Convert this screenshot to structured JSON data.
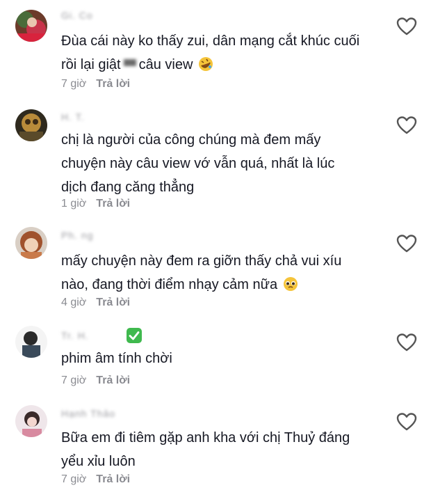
{
  "comments": [
    {
      "username": "Gi. Co",
      "text_before": "Đùa cái này ko thấy zui, dân mạng cắt khúc cuối\nrồi lại giật",
      "text_after": "câu view",
      "emoji": "rolling-on-floor-laughing",
      "time": "7 giờ",
      "reply": "Trả lời"
    },
    {
      "username": "H. T. ",
      "text": "chị là người của công chúng mà đem mấy\nchuyện này câu view vớ vẫn quá, nhất là lúc\ndịch đang căng thẳng",
      "time": "1 giờ",
      "reply": "Trả lời"
    },
    {
      "username": "Ph. ng",
      "text": "mấy chuyện này đem ra giỡn thấy chả vui xíu\nnào, đang thời điểm nhạy cảm nữa",
      "emoji": "pleading-face",
      "time": "4 giờ",
      "reply": "Trả lời"
    },
    {
      "username": "Tr. H.",
      "verified": true,
      "text": "phim âm tính chời",
      "time": "7 giờ",
      "reply": "Trả lời"
    },
    {
      "username": "Hạnh Thảo",
      "text": "Bữa em đi tiêm gặp anh kha với chị Thuỷ đáng\nyểu xỉu luôn",
      "time": "7 giờ",
      "reply": "Trả lời"
    }
  ],
  "icons": {
    "like": "heart-outline-icon",
    "verified": "check-mark-icon"
  },
  "colors": {
    "text": "#161823",
    "meta": "#8a8b91",
    "verified": "#3fb94e"
  }
}
